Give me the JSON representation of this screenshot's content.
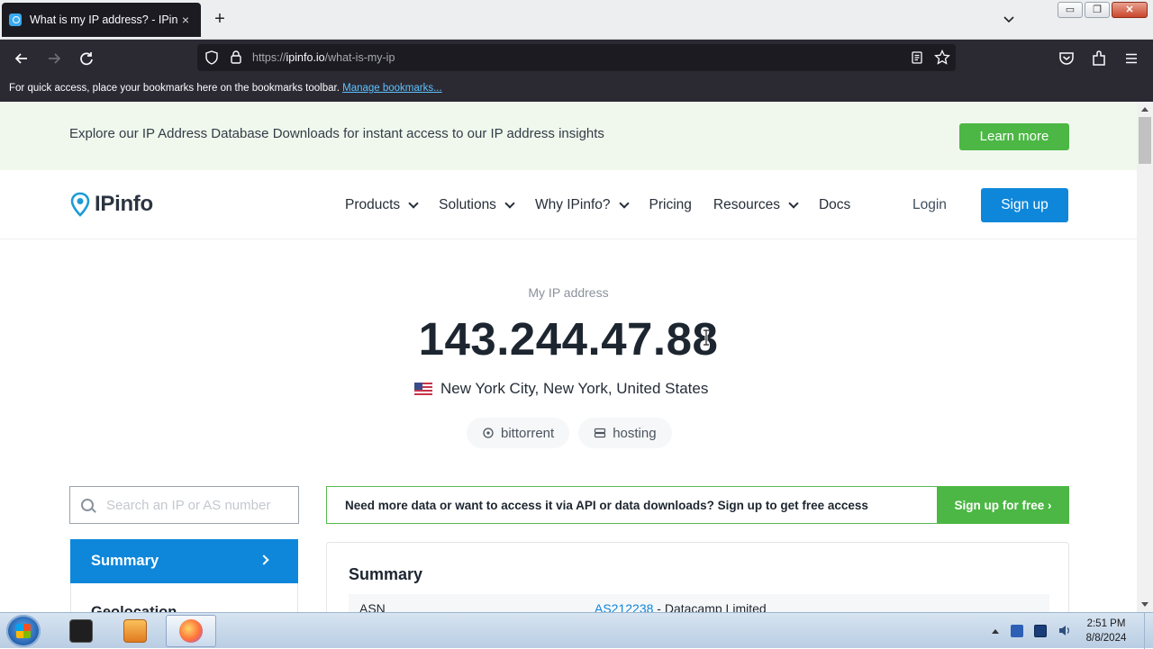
{
  "browser": {
    "tab_title": "What is my IP address? - IPinfo.io",
    "tab_close": "×",
    "new_tab": "+",
    "url_proto": "https://",
    "url_host": "ipinfo.io",
    "url_path": "/what-is-my-ip",
    "bookmarks_text": "For quick access, place your bookmarks here on the bookmarks toolbar.",
    "bookmarks_link": "Manage bookmarks..."
  },
  "promo": {
    "text": "Explore our IP Address Database Downloads for instant access to our IP address insights",
    "button": "Learn more"
  },
  "header": {
    "logo": "IPinfo",
    "menu": [
      {
        "label": "Products"
      },
      {
        "label": "Solutions"
      },
      {
        "label": "Why IPinfo?"
      },
      {
        "label": "Pricing"
      },
      {
        "label": "Resources"
      },
      {
        "label": "Docs"
      }
    ],
    "login": "Login",
    "signup": "Sign up"
  },
  "ip": {
    "label": "My IP address",
    "address": "143.244.47.88",
    "location": "New York City, New York, United States",
    "tags": [
      "bittorrent",
      "hosting"
    ]
  },
  "search": {
    "placeholder": "Search an IP or AS number"
  },
  "cta": {
    "text": "Need more data or want to access it via API or data downloads? Sign up to get free access",
    "button": "Sign up for free ›"
  },
  "sidebar": {
    "active": "Summary",
    "next": "Geolocation"
  },
  "summary": {
    "title": "Summary",
    "rows": [
      {
        "key": "ASN",
        "link": "AS212238",
        "rest": " - Datacamp Limited"
      }
    ]
  },
  "taskbar": {
    "time": "2:51 PM",
    "date": "8/8/2024"
  },
  "colors": {
    "accent_blue": "#0e87da",
    "accent_green": "#4cb744"
  }
}
